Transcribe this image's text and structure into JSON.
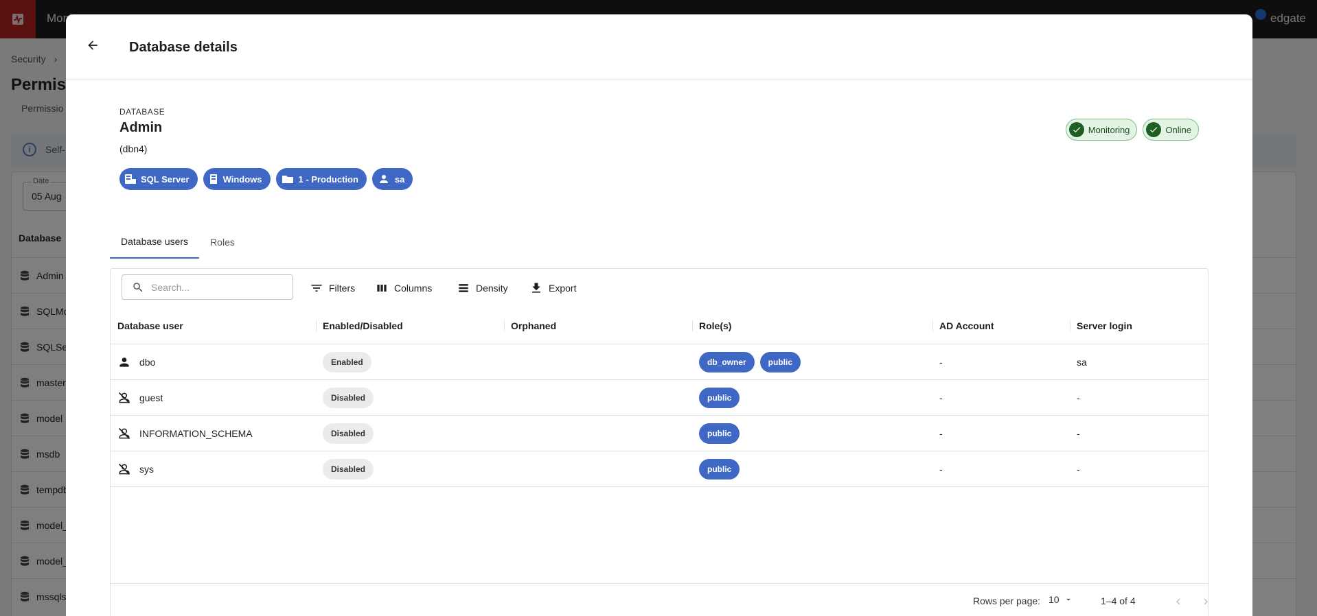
{
  "background": {
    "app_name": "Moni",
    "brand": "edgate",
    "breadcrumb": "Security",
    "page_title": "Permiss",
    "tab": "Permissio",
    "info_text": "Self-",
    "date_label": "Date",
    "date_value": "05 Aug",
    "column_header": "Database",
    "databases": [
      "Admin",
      "SQLMo",
      "SQLSer",
      "master",
      "model",
      "msdb",
      "tempdb",
      "model_",
      "model_",
      "mssqls"
    ]
  },
  "modal": {
    "title": "Database details",
    "database_kicker": "DATABASE",
    "database_name": "Admin",
    "database_sub": "(dbn4)",
    "chips": [
      {
        "label": "SQL Server",
        "icon": "sql-server-icon"
      },
      {
        "label": "Windows",
        "icon": "windows-server-icon"
      },
      {
        "label": "1 - Production",
        "icon": "folder-icon"
      },
      {
        "label": "sa",
        "icon": "person-icon"
      }
    ],
    "status": [
      {
        "label": "Monitoring",
        "icon": "check-circle-icon"
      },
      {
        "label": "Online",
        "icon": "check-circle-icon"
      }
    ],
    "tabs": [
      {
        "label": "Database users",
        "active": true
      },
      {
        "label": "Roles",
        "active": false
      }
    ],
    "toolbar": {
      "search_placeholder": "Search...",
      "filters": "Filters",
      "columns": "Columns",
      "density": "Density",
      "export": "Export"
    },
    "columns": [
      "Database user",
      "Enabled/Disabled",
      "Orphaned",
      "Role(s)",
      "AD Account",
      "Server login"
    ],
    "rows": [
      {
        "user": "dbo",
        "icon": "person-icon",
        "state": "Enabled",
        "orphaned": "",
        "roles": [
          "db_owner",
          "public"
        ],
        "ad_account": "-",
        "server_login": "sa"
      },
      {
        "user": "guest",
        "icon": "person-off-icon",
        "state": "Disabled",
        "orphaned": "",
        "roles": [
          "public"
        ],
        "ad_account": "-",
        "server_login": "-"
      },
      {
        "user": "INFORMATION_SCHEMA",
        "icon": "person-off-icon",
        "state": "Disabled",
        "orphaned": "",
        "roles": [
          "public"
        ],
        "ad_account": "-",
        "server_login": "-"
      },
      {
        "user": "sys",
        "icon": "person-off-icon",
        "state": "Disabled",
        "orphaned": "",
        "roles": [
          "public"
        ],
        "ad_account": "-",
        "server_login": "-"
      }
    ],
    "pagination": {
      "rows_per_page_label": "Rows per page:",
      "rows_per_page": "10",
      "range": "1–4 of 4"
    }
  },
  "colors": {
    "accent": "#3f67c4",
    "status_green_bg": "#e3f3e4",
    "status_green": "#1f5f24",
    "brand_red": "#b3201d"
  }
}
